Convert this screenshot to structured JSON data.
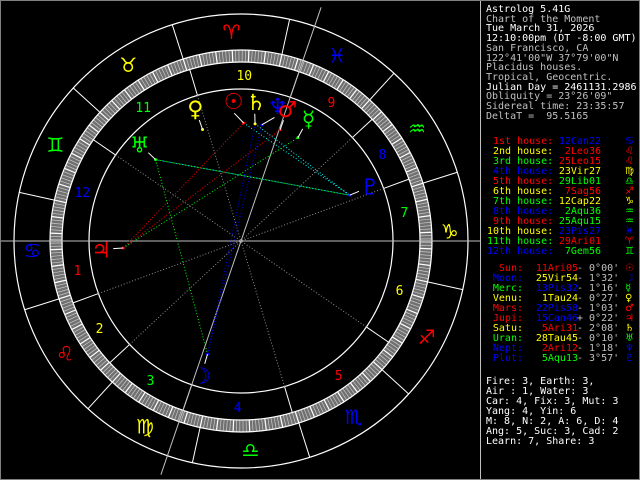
{
  "header": {
    "lines": [
      {
        "text": "Astrolog 5.41G",
        "white": true
      },
      {
        "text": "Chart of the Moment",
        "white": false
      },
      {
        "text": "Tue March 31, 2026",
        "white": true
      },
      {
        "text": "12:10:00pm (DT -8:00 GMT)",
        "white": true
      },
      {
        "text": "San Francisco, CA",
        "white": false
      },
      {
        "text": "122°41'00\"W 37°79'00\"N",
        "white": false
      },
      {
        "text": "Placidus houses.",
        "white": false
      },
      {
        "text": "Tropical, Geocentric.",
        "white": false
      },
      {
        "text": "Julian Day = 2461131.2986",
        "white": true
      },
      {
        "text": "Obliquity = 23°26'09\"",
        "white": false
      },
      {
        "text": "Sidereal time: 23:35:57",
        "white": false
      },
      {
        "text": "DeltaT =  95.5165",
        "white": false
      }
    ]
  },
  "colors": {
    "fire": "#ff0000",
    "earth": "#ffff00",
    "air": "#00ff00",
    "water": "#0000ff",
    "text": "#c0c0c0",
    "white": "#ffffff",
    "cyan": "#00ffff",
    "gray": "#a0a0a0"
  },
  "houses": [
    {
      "label": "1st house:",
      "value": "12Can22",
      "sign": "♋",
      "color": "#ff0000",
      "vcolor": "#0000ff",
      "lon": 102.37
    },
    {
      "label": "2nd house:",
      "value": "2Leo36",
      "sign": "♌",
      "color": "#ffff00",
      "vcolor": "#ff0000",
      "lon": 122.6
    },
    {
      "label": "3rd house:",
      "value": "25Leo15",
      "sign": "♌",
      "color": "#00ff00",
      "vcolor": "#ff0000",
      "lon": 145.25
    },
    {
      "label": "4th house:",
      "value": "23Vir27",
      "sign": "♍",
      "color": "#0000ff",
      "vcolor": "#ffff00",
      "lon": 173.45
    },
    {
      "label": "5th house:",
      "value": "29Lib01",
      "sign": "♎",
      "color": "#ff0000",
      "vcolor": "#00ff00",
      "lon": 209.02
    },
    {
      "label": "6th house:",
      "value": "7Sag56",
      "sign": "♐",
      "color": "#ffff00",
      "vcolor": "#ff0000",
      "lon": 247.93
    },
    {
      "label": "7th house:",
      "value": "12Cap22",
      "sign": "♑",
      "color": "#00ff00",
      "vcolor": "#ffff00",
      "lon": 282.37
    },
    {
      "label": "8th house:",
      "value": "2Aqu36",
      "sign": "♒",
      "color": "#0000ff",
      "vcolor": "#00ff00",
      "lon": 302.6
    },
    {
      "label": "9th house:",
      "value": "25Aqu15",
      "sign": "♒",
      "color": "#ff0000",
      "vcolor": "#00ff00",
      "lon": 325.25
    },
    {
      "label": "10th house:",
      "value": "23Pis27",
      "sign": "♓",
      "color": "#ffff00",
      "vcolor": "#0000ff",
      "lon": 353.45
    },
    {
      "label": "11th house:",
      "value": "29Ari01",
      "sign": "♈",
      "color": "#00ff00",
      "vcolor": "#ff0000",
      "lon": 29.02
    },
    {
      "label": "12th house:",
      "value": "7Gem56",
      "sign": "♊",
      "color": "#0000ff",
      "vcolor": "#00ff00",
      "lon": 67.93
    }
  ],
  "planets": [
    {
      "key": "sun",
      "label": "Sun:",
      "value": "11Ari05",
      "motion": "- 0°00'",
      "glyph": "☉",
      "color": "#ff0000",
      "vcolor": "#ff0000",
      "lon": 11.08
    },
    {
      "key": "moon",
      "label": "Moon:",
      "value": "25Vir54",
      "motion": "- 1°32'",
      "glyph": "☽",
      "color": "#0000ff",
      "vcolor": "#ffff00",
      "lon": 175.9
    },
    {
      "key": "mercury",
      "label": "Merc:",
      "value": "13Pis32",
      "motion": "- 1°16'",
      "glyph": "☿",
      "color": "#00ff00",
      "vcolor": "#0000ff",
      "lon": 343.53
    },
    {
      "key": "venus",
      "label": "Venu:",
      "value": "1Tau24",
      "motion": "- 0°27'",
      "glyph": "♀",
      "color": "#ffff00",
      "vcolor": "#ffff00",
      "lon": 31.4
    },
    {
      "key": "mars",
      "label": "Mars:",
      "value": "22Pis58",
      "motion": "- 1°03'",
      "glyph": "♂",
      "color": "#ff0000",
      "vcolor": "#0000ff",
      "lon": 352.97
    },
    {
      "key": "jupiter",
      "label": "Jupi:",
      "value": "15Can46",
      "motion": "+ 0°22'",
      "glyph": "♃",
      "color": "#ff0000",
      "vcolor": "#0000ff",
      "lon": 105.77
    },
    {
      "key": "saturn",
      "label": "Satu:",
      "value": "5Ari31",
      "motion": "- 2°08'",
      "glyph": "♄",
      "color": "#ffff00",
      "vcolor": "#ff0000",
      "lon": 5.52
    },
    {
      "key": "uranus",
      "label": "Uran:",
      "value": "28Tau45",
      "motion": "- 0°10'",
      "glyph": "♅",
      "color": "#00ff00",
      "vcolor": "#ffff00",
      "lon": 58.75
    },
    {
      "key": "neptune",
      "label": "Nept:",
      "value": "2Ari12",
      "motion": "- 1°18'",
      "glyph": "♆",
      "color": "#0000ff",
      "vcolor": "#ff0000",
      "lon": 2.2
    },
    {
      "key": "pluto",
      "label": "Plut:",
      "value": "5Aqu13",
      "motion": "- 3°57'",
      "glyph": "♇",
      "color": "#0000ff",
      "vcolor": "#00ff00",
      "lon": 305.22
    }
  ],
  "signs": [
    {
      "glyph": "♈",
      "color": "#ff0000"
    },
    {
      "glyph": "♉",
      "color": "#ffff00"
    },
    {
      "glyph": "♊",
      "color": "#00ff00"
    },
    {
      "glyph": "♋",
      "color": "#0000ff"
    },
    {
      "glyph": "♌",
      "color": "#ff0000"
    },
    {
      "glyph": "♍",
      "color": "#ffff00"
    },
    {
      "glyph": "♎",
      "color": "#00ff00"
    },
    {
      "glyph": "♏",
      "color": "#0000ff"
    },
    {
      "glyph": "♐",
      "color": "#ff0000"
    },
    {
      "glyph": "♑",
      "color": "#ffff00"
    },
    {
      "glyph": "♒",
      "color": "#00ff00"
    },
    {
      "glyph": "♓",
      "color": "#0000ff"
    }
  ],
  "aspects": [
    {
      "a": "uranus",
      "b": "pluto",
      "color": "#00ffff"
    },
    {
      "a": "saturn",
      "b": "pluto",
      "color": "#00ffff"
    },
    {
      "a": "sun",
      "b": "pluto",
      "color": "#00ffff"
    },
    {
      "a": "jupiter",
      "b": "mars",
      "color": "#ff0000"
    },
    {
      "a": "jupiter",
      "b": "sun",
      "color": "#ff0000"
    },
    {
      "a": "pluto",
      "b": "uranus",
      "color": "#00ff00"
    },
    {
      "a": "uranus",
      "b": "moon",
      "color": "#00ff00"
    },
    {
      "a": "jupiter",
      "b": "mercury",
      "color": "#00ff00"
    },
    {
      "a": "moon",
      "b": "neptune",
      "color": "#0000ff"
    },
    {
      "a": "moon",
      "b": "saturn",
      "color": "#0000ff"
    }
  ],
  "summary": [
    "Fire: 3, Earth: 3,",
    "Air : 1, Water: 3",
    "Car: 4, Fix: 3, Mut: 3",
    "Yang: 4, Yin: 6",
    "M: 8, N: 2, A: 6, D: 4",
    "Ang: 5, Suc: 3, Cad: 2",
    "Learn: 7, Share: 3"
  ]
}
